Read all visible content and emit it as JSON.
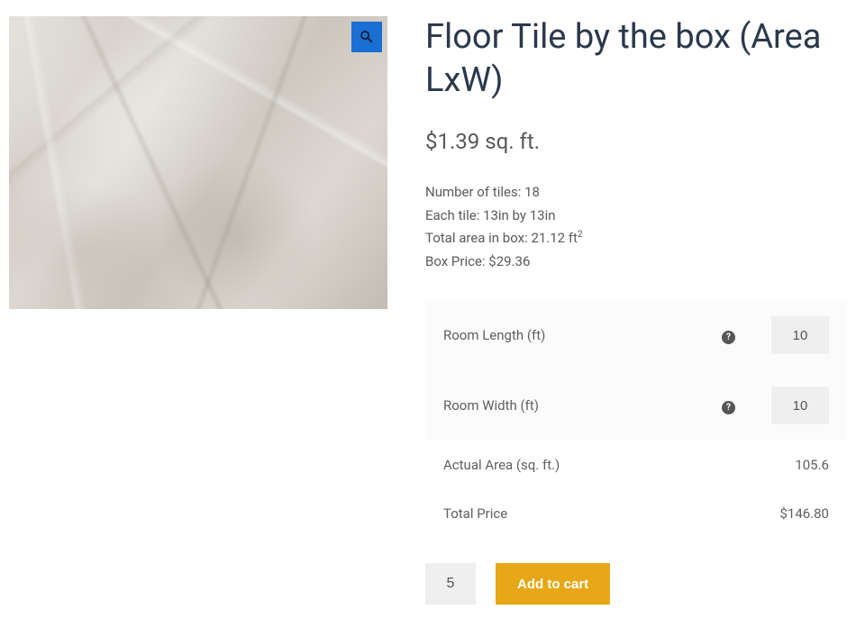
{
  "product": {
    "title": "Floor Tile by the box (Area LxW)",
    "price_line": "$1.39 sq. ft."
  },
  "specs": {
    "tiles_label": "Number of tiles:",
    "tiles_value": "18",
    "each_label": "Each tile:",
    "each_value": "13in by 13in",
    "area_label": "Total area in box:",
    "area_value": "21.12 ft",
    "area_exp": "2",
    "boxprice_label": "Box Price:",
    "boxprice_value": "$29.36"
  },
  "calc": {
    "length_label": "Room Length (ft)",
    "length_value": "10",
    "width_label": "Room Width (ft)",
    "width_value": "10",
    "actual_label": "Actual Area (sq. ft.)",
    "actual_value": "105.6",
    "total_label": "Total Price",
    "total_value": "$146.80",
    "help_char": "?"
  },
  "cart": {
    "qty": "5",
    "button": "Add to cart"
  }
}
